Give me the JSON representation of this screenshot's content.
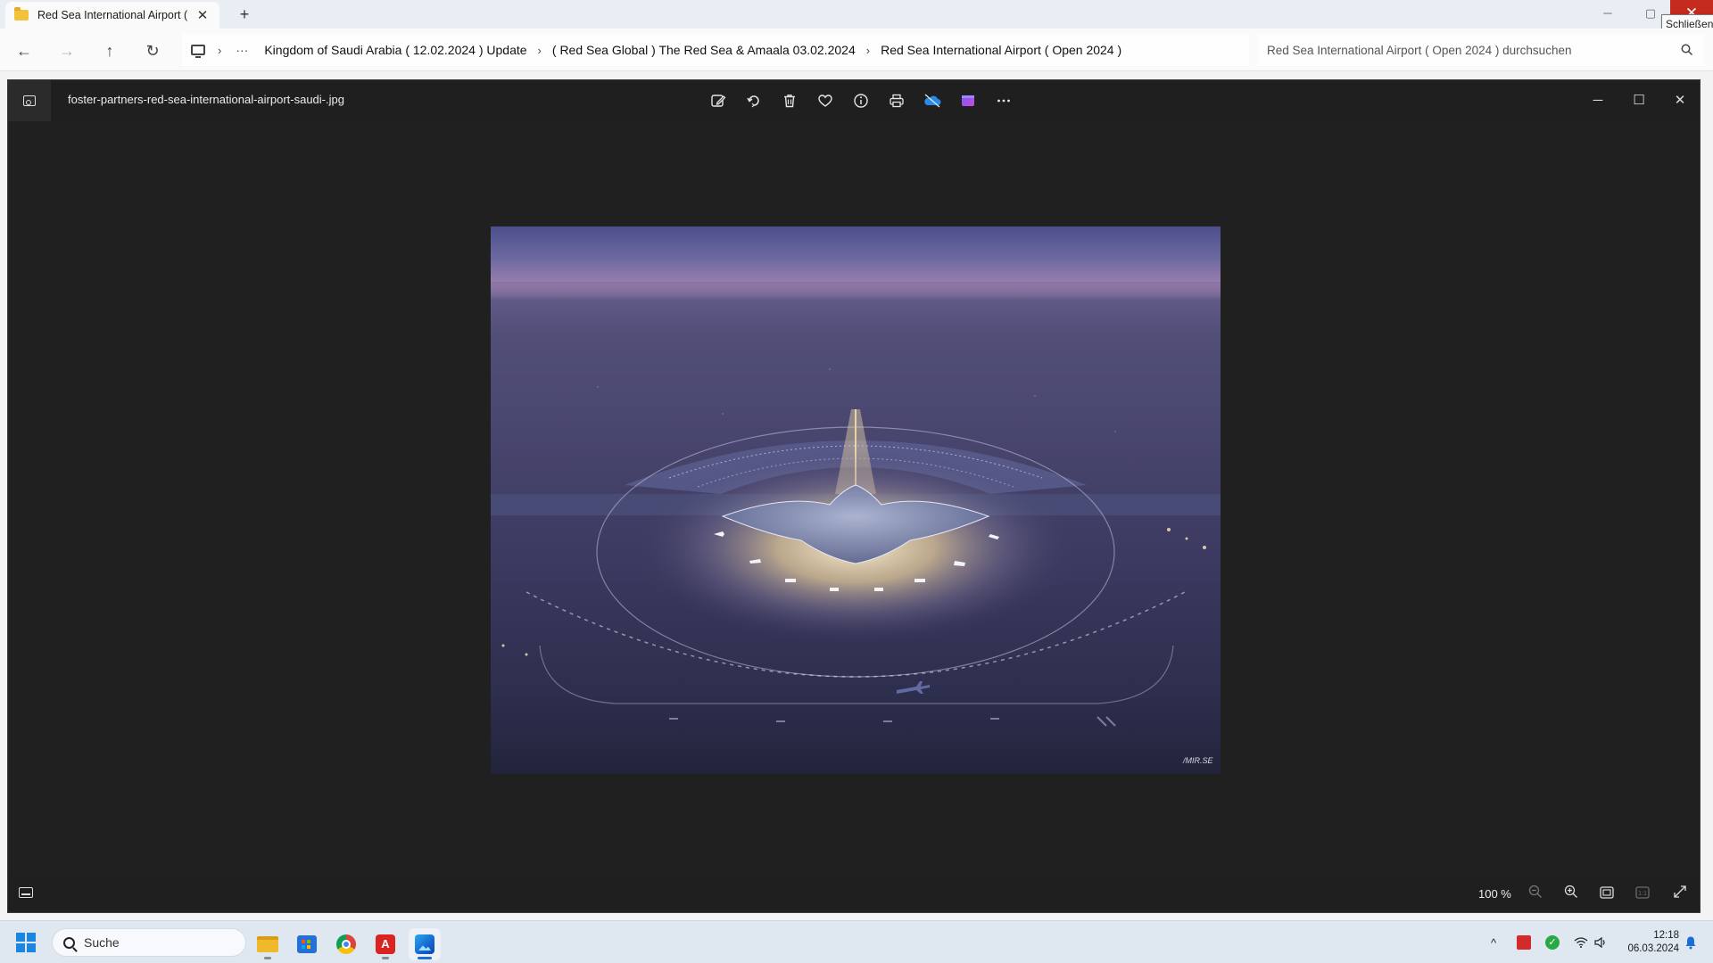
{
  "explorer": {
    "tab": {
      "title": "Red Sea International Airport (",
      "close_glyph": "✕"
    },
    "new_tab_glyph": "+",
    "window_controls": {
      "minimize": "─",
      "maximize": "▢",
      "close": "✕"
    },
    "close_tooltip": "Schließen",
    "nav": {
      "back": "←",
      "forward": "→",
      "up": "↑",
      "refresh": "↻"
    },
    "breadcrumb": {
      "more": "···",
      "separator": "›",
      "items": [
        "Kingdom of Saudi Arabia ( 12.02.2024 ) Update",
        "( Red Sea Global ) The Red Sea & Amaala 03.02.2024",
        "Red Sea International Airport ( Open 2024 )"
      ]
    },
    "search": {
      "placeholder": "Red Sea International Airport ( Open 2024 ) durchsuchen"
    }
  },
  "viewer": {
    "file_name": "foster-partners-red-sea-international-airport-saudi-.jpg",
    "toolbar": [
      "edit-image",
      "rotate",
      "delete",
      "favorite",
      "file-info",
      "print",
      "onedrive",
      "clipchamp",
      "more-options"
    ],
    "window_controls": {
      "minimize": "─",
      "maximize": "☐",
      "close": "✕"
    },
    "image": {
      "subject": "Aerial night rendering of Red Sea International Airport",
      "watermark": "/MIR.SE"
    },
    "status": {
      "zoom": "100 %",
      "zoom_out": "−",
      "zoom_in": "+",
      "fit": "▭",
      "actual_size": "1:1",
      "fullscreen": "⤢"
    }
  },
  "taskbar": {
    "search_label": "Suche",
    "apps": [
      "file-explorer",
      "microsoft-store",
      "chrome",
      "acrobat",
      "photos"
    ],
    "tray": {
      "chevron": "^",
      "wifi": "wifi-icon",
      "volume": "volume-icon"
    },
    "clock": {
      "time": "12:18",
      "date": "06.03.2024"
    }
  },
  "colors": {
    "viewer_bg": "#202020",
    "accent": "#1a6fd4",
    "close_red": "#c42b1c"
  }
}
